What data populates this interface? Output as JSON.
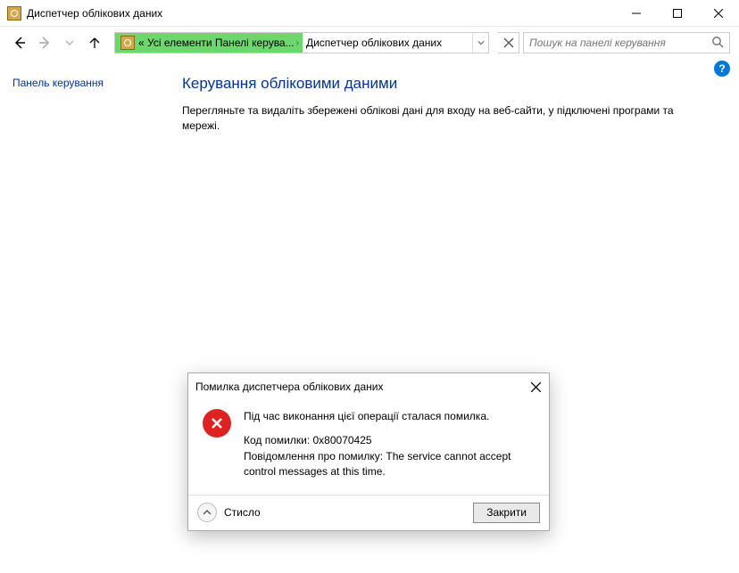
{
  "window": {
    "title": "Диспетчер облікових даних"
  },
  "breadcrumb": {
    "root_prefix": "«",
    "root": "Усі елементи Панелі керува...",
    "current": "Диспетчер облікових даних"
  },
  "search": {
    "placeholder": "Пошук на панелі керування"
  },
  "sidebar": {
    "home_link": "Панель керування"
  },
  "main": {
    "heading": "Керування обліковими даними",
    "description": "Перегляньте та видаліть збережені облікові дані для входу на веб-сайти, у підключені програми та мережі."
  },
  "dialog": {
    "title": "Помилка диспетчера облікових даних",
    "headline": "Під час виконання цієї операції сталася помилка.",
    "code_label": "Код помилки:",
    "code_value": "0x80070425",
    "message_label": "Повідомлення про помилку:",
    "message_value": "The service cannot accept control messages at this time.",
    "details_label": "Стисло",
    "close_label": "Закрити"
  }
}
